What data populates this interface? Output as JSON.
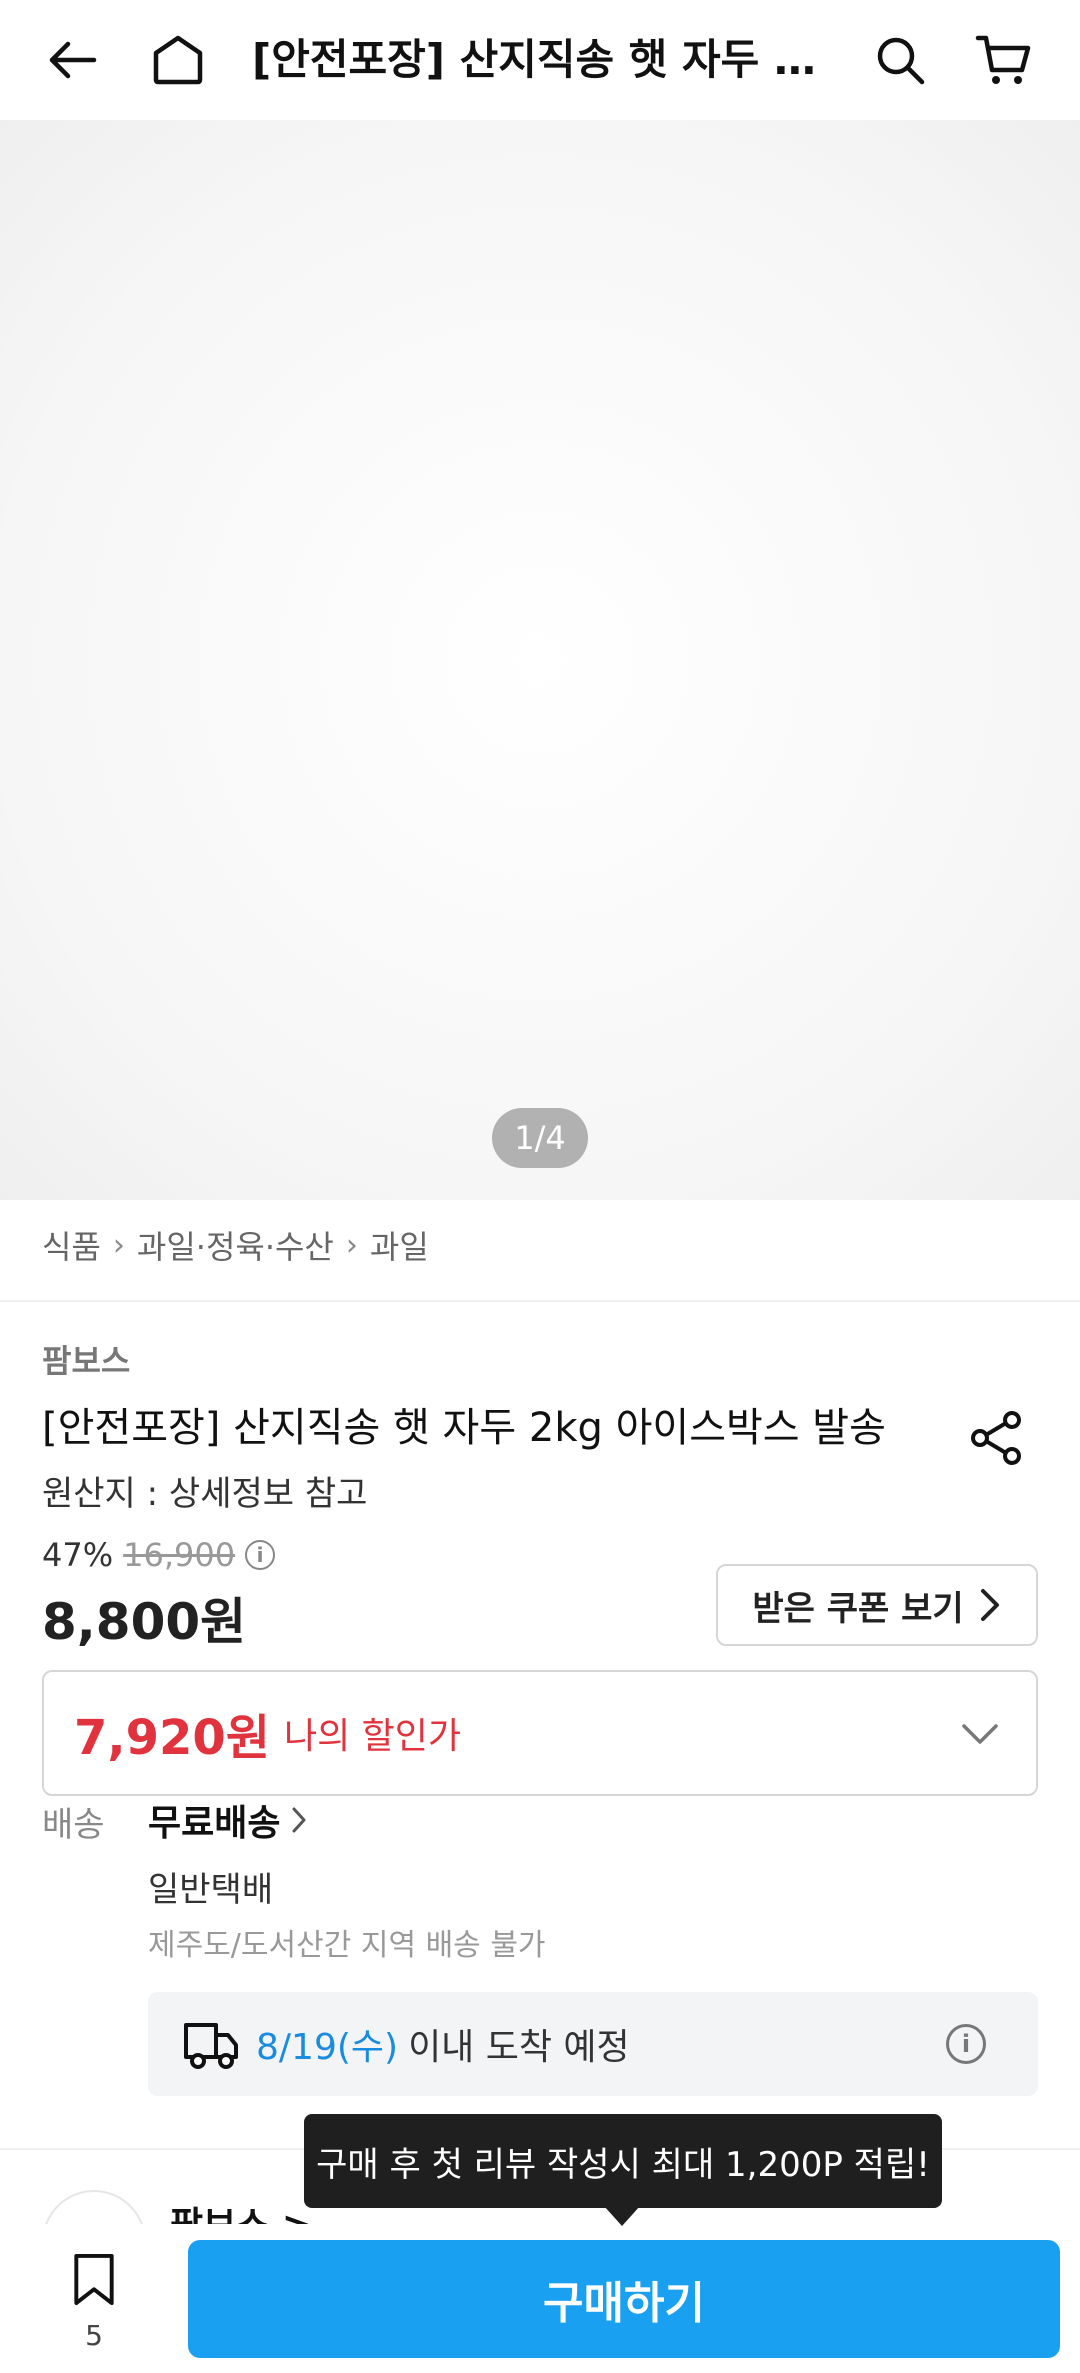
{
  "header": {
    "title": "[안전포장] 산지직송 햇 자두 2kg 아이스박스 발송",
    "back_icon": "back-arrow-icon",
    "home_icon": "home-icon",
    "search_icon": "search-icon",
    "cart_icon": "cart-icon"
  },
  "gallery": {
    "pager": "1/4"
  },
  "breadcrumb": {
    "items": [
      "식품",
      "과일·정육·수산",
      "과일"
    ]
  },
  "product": {
    "brand": "팜보스",
    "title": "[안전포장] 산지직송 햇 자두 2kg 아이스박스 발송",
    "origin": "원산지 : 상세정보 참고",
    "discount_rate": "47%",
    "original_price": "16,900",
    "price": "8,800원",
    "coupon_button": "받은 쿠폰 보기",
    "my_price": "7,920원",
    "my_price_label": "나의 할인가"
  },
  "shipping": {
    "label": "배송",
    "fee": "무료배송",
    "type": "일반택배",
    "note": "제주도/도서산간 지역 배송 불가",
    "eta_date": "8/19(수)",
    "eta_text": "이내 도착 예정"
  },
  "seller": {
    "name": "팜보스 >"
  },
  "tooltip": {
    "text": "구매 후 첫 리뷰 작성시 최대 1,200P 적립!"
  },
  "bottom": {
    "bookmark_count": "5",
    "buy_button": "구매하기"
  },
  "colors": {
    "accent": "#1aa0f0",
    "discount_red": "#e0333d",
    "eta_blue": "#1a8ce0"
  }
}
